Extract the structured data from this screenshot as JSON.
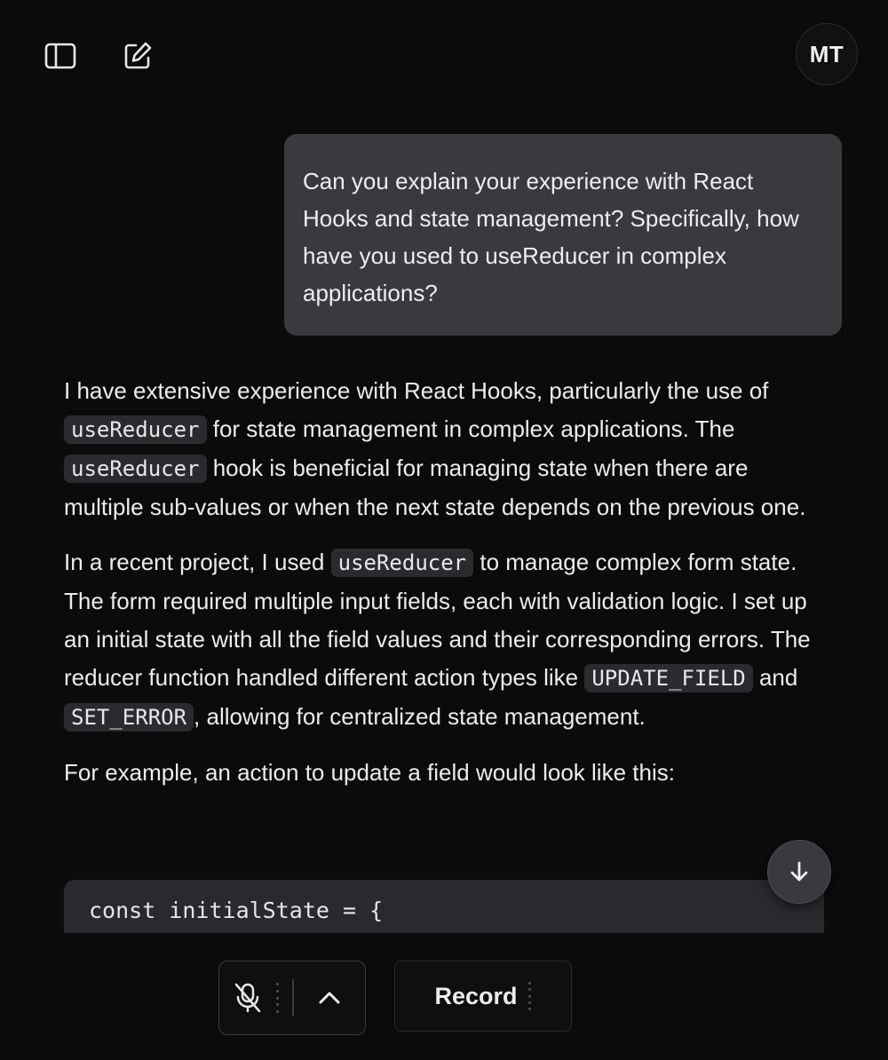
{
  "header": {
    "sidebar_toggle_icon": "sidebar-icon",
    "new_chat_icon": "edit-icon",
    "avatar_initials": "MT"
  },
  "conversation": {
    "user_message": "Can you explain your experience with React Hooks and state management? Specifically, how have you used to useReducer in complex applications?",
    "assistant_paragraphs": {
      "p1": {
        "t1": "I have extensive experience with React Hooks, particularly the use of ",
        "c1": "useReducer",
        "t2": " for state management in complex applications. The ",
        "c2": "useReducer",
        "t3": " hook is beneficial for managing state when there are multiple sub-values or when the next state depends on the previous one."
      },
      "p2": {
        "t1": "In a recent project, I used ",
        "c1": "useReducer",
        "t2": " to manage complex form state. The form required multiple input fields, each with validation logic. I set up an initial state with all the field values and their corresponding errors. The reducer function handled different action types like ",
        "c2": "UPDATE_FIELD",
        "t3": " and ",
        "c3": "SET_ERROR",
        "t4": ", allowing for centralized state management."
      },
      "p3": {
        "t1": "For example, an action to update a field would look like this:"
      }
    },
    "code_block_first_line": "const initialState = {"
  },
  "controls": {
    "scroll_down_icon": "arrow-down-icon",
    "mic_icon": "mic-off-icon",
    "chevron_icon": "chevron-up-icon",
    "record_label": "Record"
  },
  "colors": {
    "background": "#0b0b0c",
    "user_bubble": "#3a3a3e",
    "code_background": "#2a2a2e",
    "inline_code_background": "#2b2b2f"
  }
}
